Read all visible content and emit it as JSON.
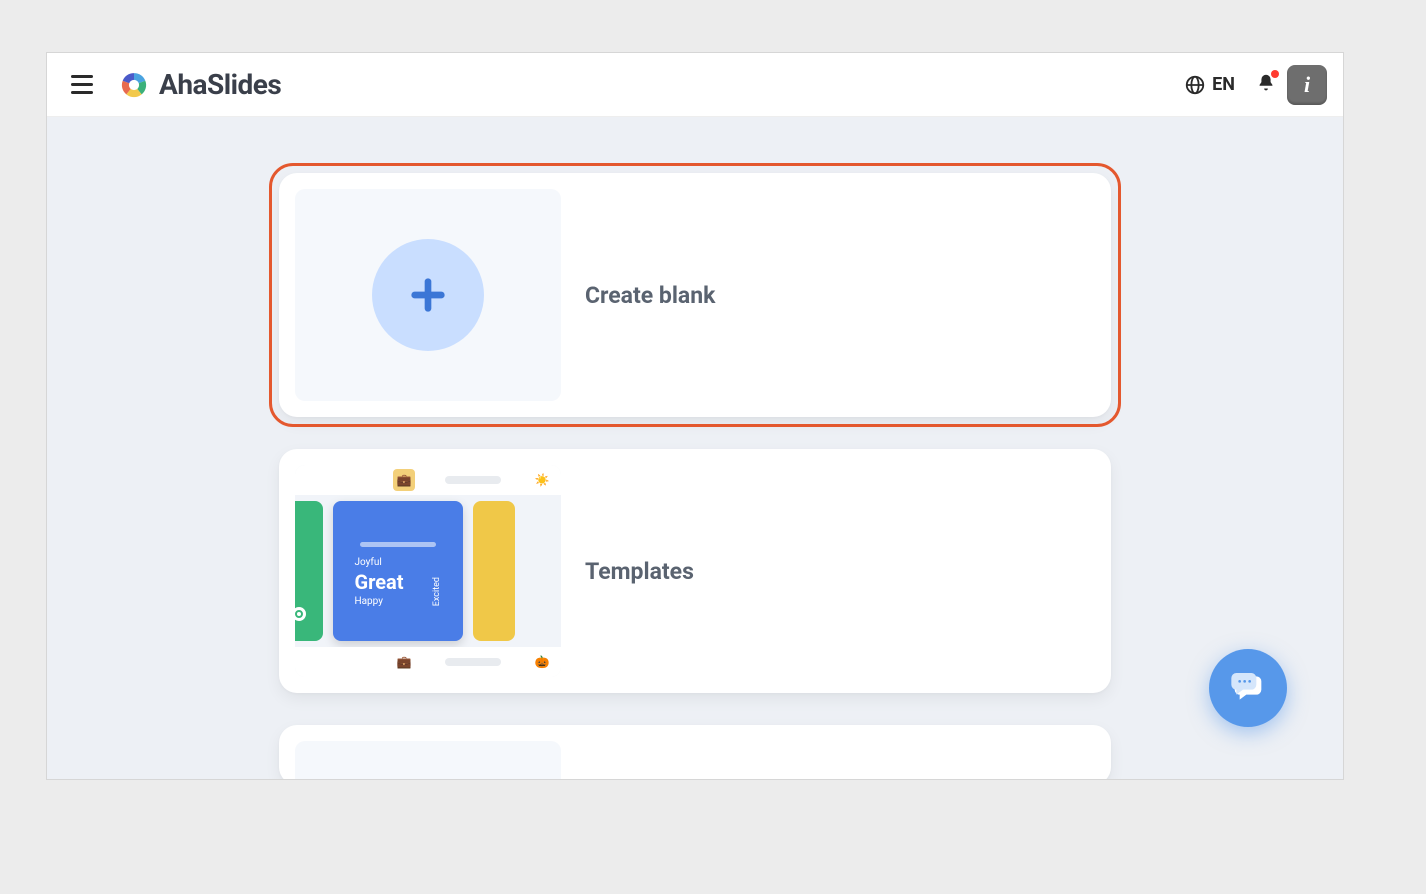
{
  "header": {
    "brand": "AhaSlides",
    "language_code": "EN"
  },
  "cards": {
    "create_blank": {
      "label": "Create blank"
    },
    "templates": {
      "label": "Templates",
      "thumb_words": {
        "top": "Joyful",
        "main": "Great",
        "bottom": "Happy",
        "side": "Excited"
      }
    }
  }
}
